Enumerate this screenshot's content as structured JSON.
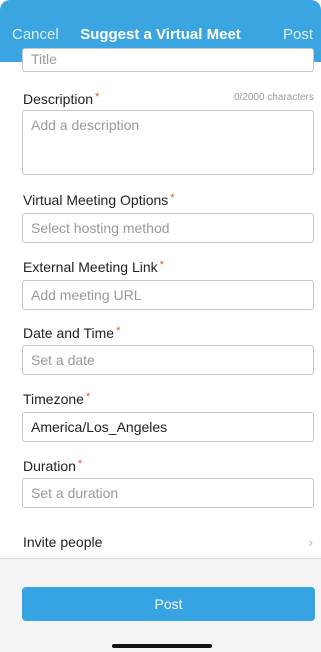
{
  "header": {
    "cancel_label": "Cancel",
    "title": "Suggest a Virtual Meet",
    "post_label": "Post"
  },
  "title_field": {
    "placeholder": "Title"
  },
  "description": {
    "label": "Description",
    "required": "*",
    "counter": "0/2000 characters",
    "placeholder": "Add a description"
  },
  "hosting": {
    "label": "Virtual Meeting Options",
    "required": "*",
    "placeholder": "Select hosting method"
  },
  "link": {
    "label": "External Meeting Link",
    "required": "*",
    "placeholder": "Add meeting URL"
  },
  "datetime": {
    "label": "Date and Time",
    "required": "*",
    "placeholder": "Set a date"
  },
  "timezone": {
    "label": "Timezone",
    "required": "*",
    "value": "America/Los_Angeles"
  },
  "duration": {
    "label": "Duration",
    "required": "*",
    "placeholder": "Set a duration"
  },
  "invite": {
    "label": "Invite people",
    "chevron": "›"
  },
  "footer": {
    "post_button_label": "Post"
  },
  "icons": {
    "invite_chevron": "chevron-right-icon"
  },
  "colors": {
    "accent": "#3aa5e0",
    "required": "#e0523d"
  }
}
